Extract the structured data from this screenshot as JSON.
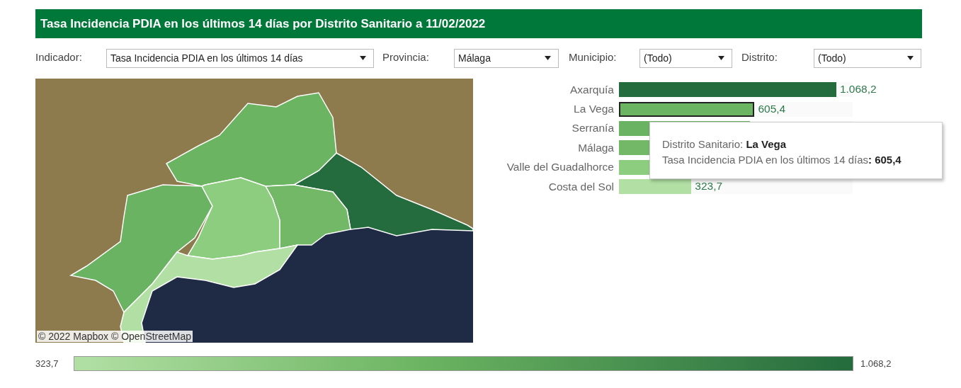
{
  "title": "Tasa Incidencia PDIA en los últimos 14 días por Distrito Sanitario a 11/02/2022",
  "filters": [
    {
      "label": "Indicador:",
      "value": "Tasa Incidencia PDIA en los últimos 14 días"
    },
    {
      "label": "Provincia:",
      "value": "Málaga"
    },
    {
      "label": "Municipio:",
      "value": "(Todo)"
    },
    {
      "label": "Distrito:",
      "value": "(Todo)"
    }
  ],
  "map": {
    "attribution": "© 2022 Mapbox © OpenStreetMap"
  },
  "districts": [
    {
      "name": "Axarquía",
      "value": "1.068,2",
      "level": 0.93,
      "color": "#246b3d",
      "selected": false
    },
    {
      "name": "La Vega",
      "value": "605,4",
      "level": 0.58,
      "color": "#6bb461",
      "selected": true
    },
    {
      "name": "Serranía",
      "level": 0.56,
      "color": "#6ab363",
      "selected": false
    },
    {
      "name": "Málaga",
      "level": 0.5,
      "color": "#72b867",
      "selected": false
    },
    {
      "name": "Valle del Guadalhorce",
      "level": 0.45,
      "color": "#8ccd7f",
      "selected": false
    },
    {
      "name": "Costa del Sol",
      "value": "323,7",
      "level": 0.31,
      "color": "#b2e0a4",
      "selected": false
    }
  ],
  "tooltip": {
    "line_1": "Distrito Sanitario: **La Vega**",
    "line_2": "Tasa Incidencia PDIA en los últimos 14 días**: 605,4**"
  },
  "legend": {
    "min": "323,7",
    "max": "1.068,2"
  }
}
